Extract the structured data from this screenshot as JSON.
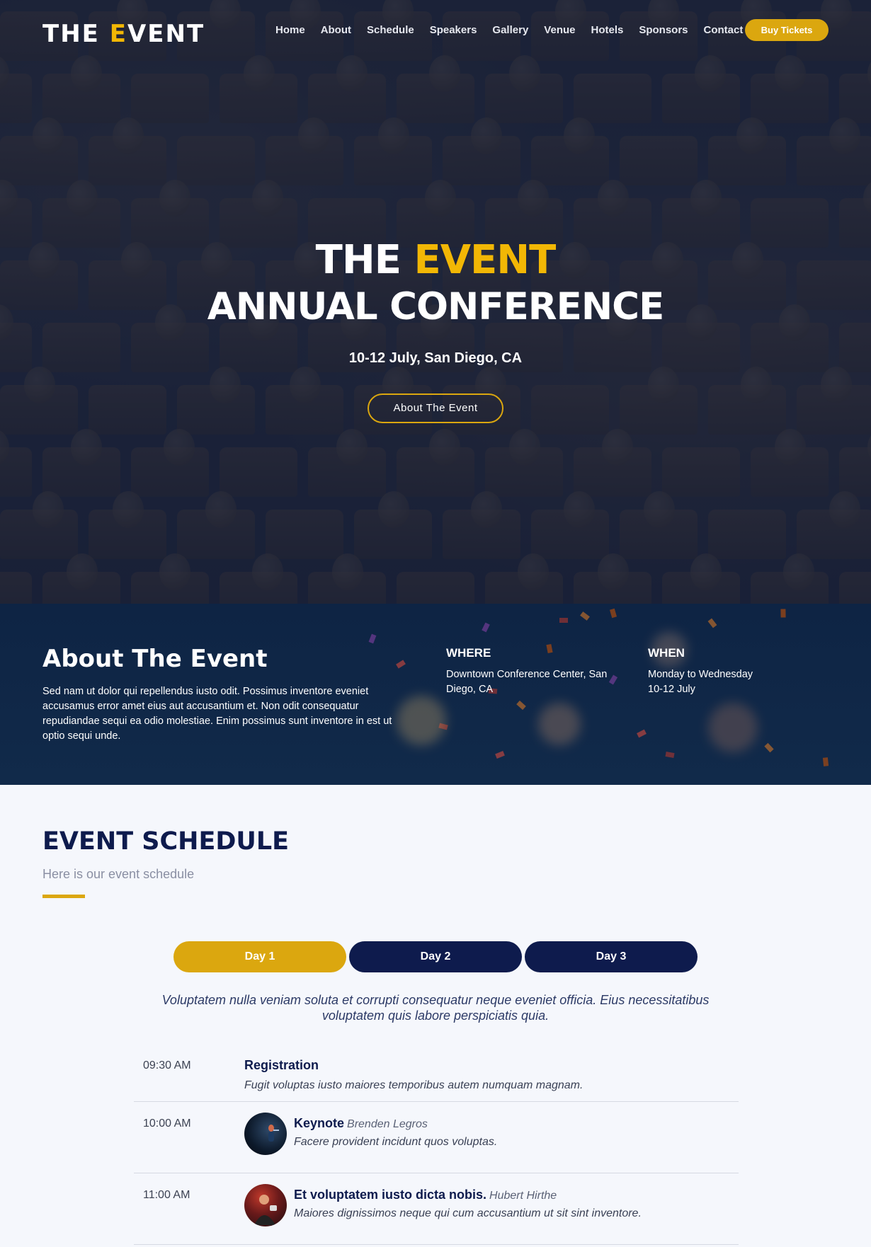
{
  "nav": {
    "logo_the": "THE ",
    "logo_e": "E",
    "logo_vent": "VENT",
    "links": [
      "Home",
      "About",
      "Schedule",
      "Speakers",
      "Gallery",
      "Venue",
      "Hotels",
      "Sponsors",
      "Contact"
    ],
    "buy_label": "Buy Tickets"
  },
  "hero": {
    "title_the": "THE",
    "title_event": "EVENT",
    "title_line2": "ANNUAL CONFERENCE",
    "date": "10-12 July, San Diego, CA",
    "cta_label": "About The Event"
  },
  "about": {
    "title": "About The Event",
    "body": "Sed nam ut dolor qui repellendus iusto odit. Possimus inventore eveniet accusamus error amet eius aut accusantium et. Non odit consequatur repudiandae sequi ea odio molestiae. Enim possimus sunt inventore in est ut optio sequi unde.",
    "where_title": "WHERE",
    "where_body": "Downtown Conference Center, San Diego, CA",
    "when_title": "WHEN",
    "when_line1": "Monday to Wednesday",
    "when_line2": "10-12 July"
  },
  "schedule": {
    "title": "EVENT SCHEDULE",
    "subtitle": "Here is our event schedule",
    "tabs": [
      {
        "label": "Day 1",
        "active": true
      },
      {
        "label": "Day 2",
        "active": false
      },
      {
        "label": "Day 3",
        "active": false
      }
    ],
    "description": "Voluptatem nulla veniam soluta et corrupti consequatur neque eveniet officia. Eius necessitatibus voluptatem quis labore perspiciatis quia.",
    "items": [
      {
        "time": "09:30 AM",
        "title": "Registration",
        "speaker": "",
        "desc": "Fugit voluptas iusto maiores temporibus autem numquam magnam."
      },
      {
        "time": "10:00 AM",
        "title": "Keynote",
        "speaker": "Brenden Legros",
        "desc": "Facere provident incidunt quos voluptas."
      },
      {
        "time": "11:00 AM",
        "title": "Et voluptatem iusto dicta nobis.",
        "speaker": "Hubert Hirthe",
        "desc": "Maiores dignissimos neque qui cum accusantium ut sit sint inventore."
      }
    ]
  },
  "colors": {
    "accent": "#dba70f",
    "navy": "#0e1b4d",
    "strip": "#0e2444"
  }
}
